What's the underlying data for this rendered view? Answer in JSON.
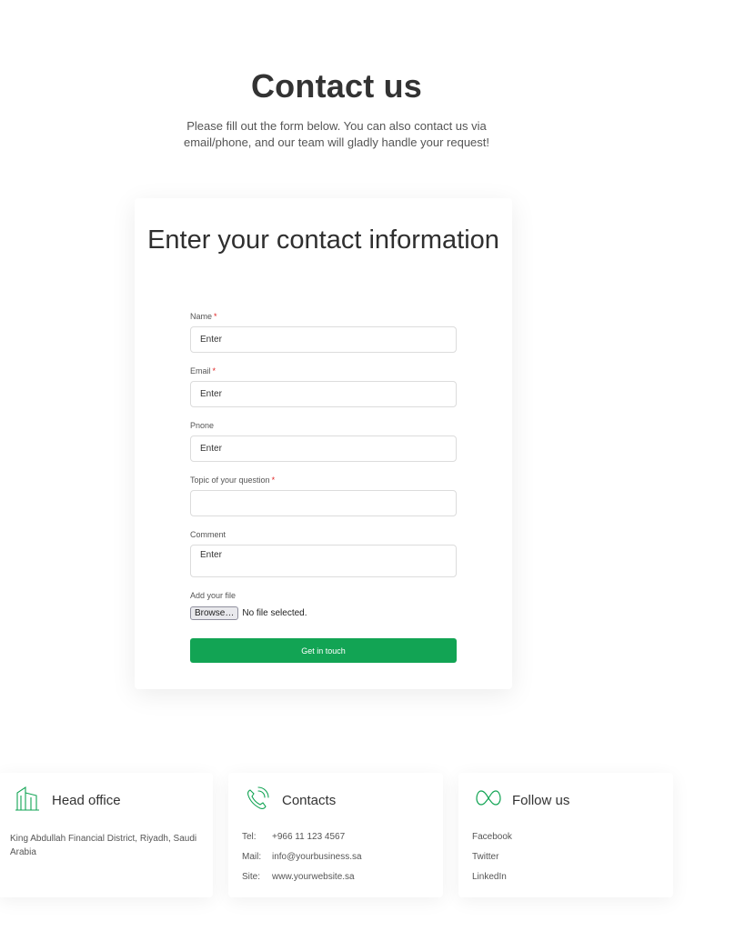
{
  "header": {
    "title": "Contact us",
    "subtitle": "Please fill out the form below. You can also contact us via email/phone, and our team will gladly handle your request!"
  },
  "form": {
    "heading": "Enter your contact information",
    "fields": {
      "name": {
        "label": "Name",
        "required_mark": "*",
        "placeholder": "Enter"
      },
      "email": {
        "label": "Email",
        "required_mark": "*",
        "placeholder": "Enter"
      },
      "phone": {
        "label": "Pnone",
        "placeholder": "Enter"
      },
      "topic": {
        "label": "Topic of your question",
        "required_mark": "*",
        "value": ""
      },
      "comment": {
        "label": "Comment",
        "placeholder": "Enter"
      },
      "file": {
        "label": "Add your file",
        "button_label": "Browse…",
        "status": "No file selected."
      }
    },
    "submit_label": "Get in touch"
  },
  "footer": {
    "head_office": {
      "icon": "building-icon",
      "title": "Head office",
      "address": "King Abdullah Financial District, Riyadh, Saudi Arabia"
    },
    "contacts": {
      "icon": "phone-icon",
      "title": "Contacts",
      "rows": [
        {
          "key": "Tel:",
          "value": "+966 11 123 4567"
        },
        {
          "key": "Mail:",
          "value": "info@yourbusiness.sa"
        },
        {
          "key": "Site:",
          "value": "www.yourwebsite.sa"
        }
      ]
    },
    "follow_us": {
      "icon": "meta-icon",
      "title": "Follow us",
      "links": [
        "Facebook",
        "Twitter",
        "LinkedIn"
      ]
    }
  },
  "colors": {
    "accent": "#12a454",
    "required": "#e02424",
    "text": "#333333"
  }
}
